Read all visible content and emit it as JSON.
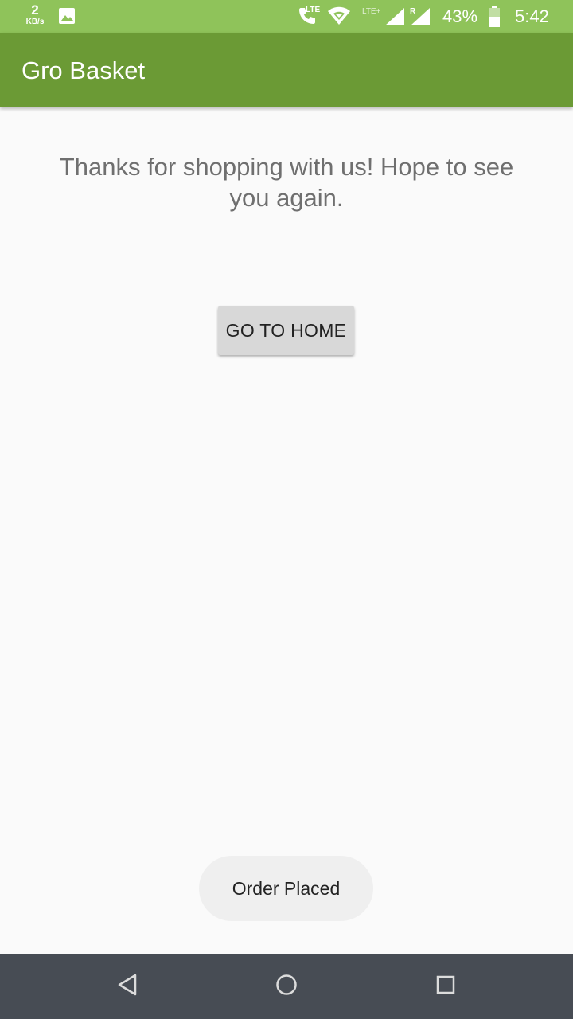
{
  "status_bar": {
    "net_speed_value": "2",
    "net_speed_unit": "KB/s",
    "lte_label": "LTE",
    "lte_plus_label": "LTE+",
    "roaming_label": "R",
    "battery_percent": "43%",
    "time": "5:42",
    "icons": [
      "gallery-icon",
      "volte-call-icon",
      "wifi-icon",
      "signal-icon",
      "signal-roaming-icon",
      "battery-icon"
    ]
  },
  "app_bar": {
    "title": "Gro Basket"
  },
  "main": {
    "message": "Thanks for shopping with us! Hope to see you again.",
    "home_button_label": "GO TO HOME"
  },
  "toast": {
    "text": "Order Placed"
  },
  "nav_bar": {
    "icons": [
      "back-icon",
      "home-icon",
      "recents-icon"
    ]
  },
  "colors": {
    "status_bar": "#8fc35a",
    "app_bar": "#6b9a35",
    "background": "#fafafa",
    "nav_bar": "#474c54"
  }
}
